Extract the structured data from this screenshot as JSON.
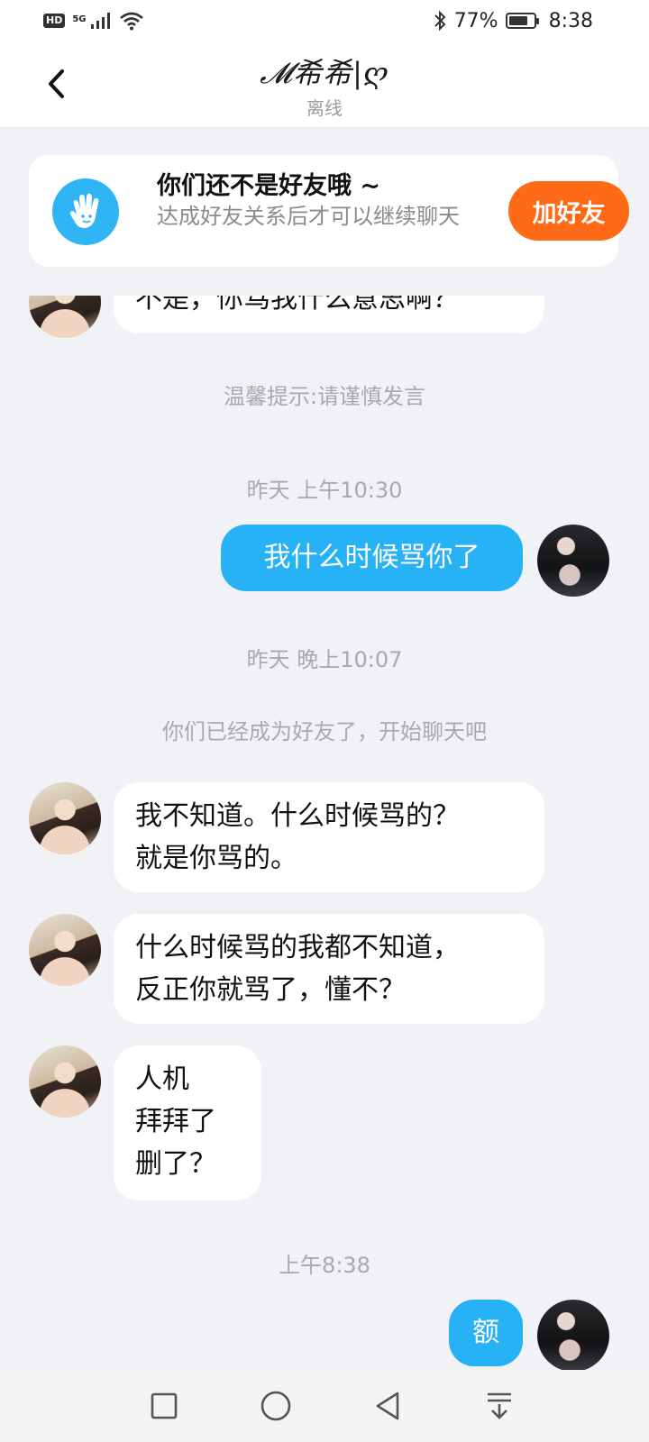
{
  "statusbar": {
    "hd": "HD",
    "network": "5G",
    "battery_percent": "77%",
    "battery_level": 0.77,
    "time": "8:38"
  },
  "header": {
    "title": "𝓜希希|ღ",
    "status": "离线"
  },
  "friend_banner": {
    "title": "你们还不是好友哦 ~",
    "description": "达成好友关系后才可以继续聊天",
    "button_label": "加好友"
  },
  "messages": {
    "m0": "不是，你骂我什么意思啊？",
    "tip": "温馨提示:请谨慎发言",
    "ts1": "昨天 上午10:30",
    "m1": "我什么时候骂你了",
    "ts2": "昨天 晚上10:07",
    "sys_friends": "你们已经成为好友了，开始聊天吧",
    "m2_line1": "我不知道。什么时候骂的？",
    "m2_line2": "就是你骂的。",
    "m3_line1": "什么时候骂的我都不知道，",
    "m3_line2": "反正你就骂了，懂不？",
    "m4_line1": "人机",
    "m4_line2": "拜拜了",
    "m4_line3": "删了？",
    "ts3": "上午8:38",
    "m5": "额"
  },
  "colors": {
    "outgoing_bubble": "#27b2f6",
    "add_friend_button": "#ff6a16",
    "banner_icon": "#2fb4f4"
  },
  "icons": {
    "back": "chevron-left-icon",
    "banner": "hand-wave-icon",
    "nav": [
      "square-icon",
      "circle-icon",
      "triangle-back-icon",
      "notification-pull-icon"
    ]
  }
}
